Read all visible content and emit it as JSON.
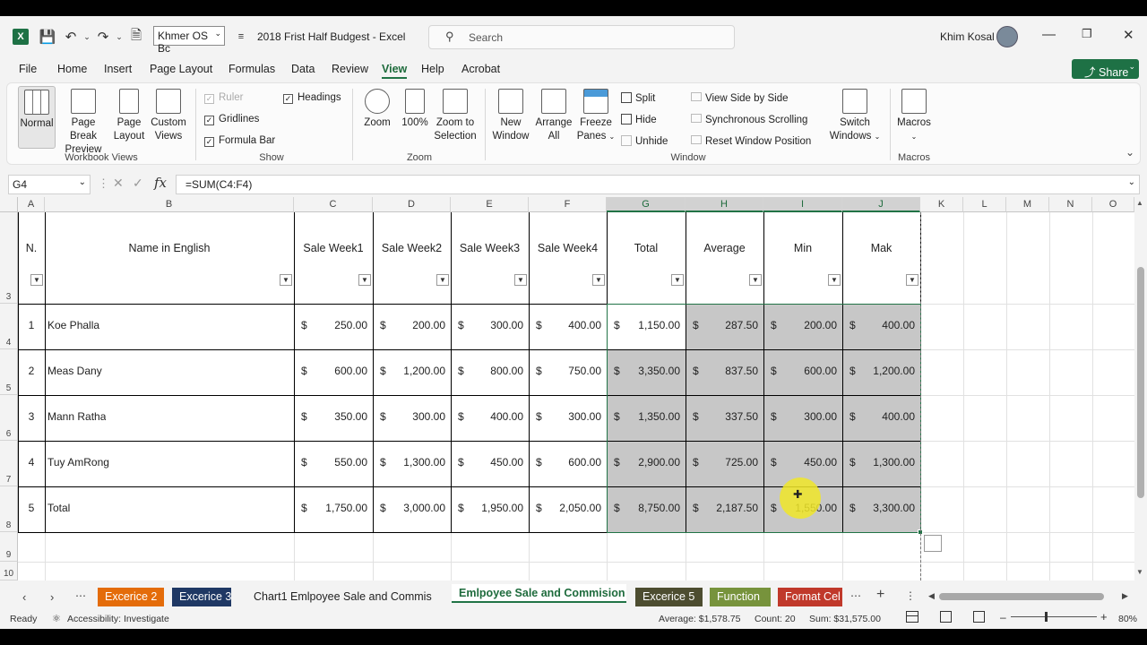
{
  "titlebar": {
    "font_name": "Khmer OS Bc",
    "doc_title": "2018 Frist Half Budgest  -  Excel",
    "search_placeholder": "Search",
    "user_name": "Khim Kosal"
  },
  "menu": {
    "items": [
      "File",
      "Home",
      "Insert",
      "Page Layout",
      "Formulas",
      "Data",
      "Review",
      "View",
      "Help",
      "Acrobat"
    ],
    "active": "View",
    "share_label": "Share"
  },
  "ribbon": {
    "workbook_views": {
      "label": "Workbook Views",
      "normal": "Normal",
      "page_break": "Page Break",
      "page_break2": "Preview",
      "page_layout": "Page",
      "page_layout2": "Layout",
      "custom_views": "Custom",
      "custom_views2": "Views"
    },
    "show": {
      "label": "Show",
      "ruler": "Ruler",
      "gridlines": "Gridlines",
      "formula_bar": "Formula Bar",
      "headings": "Headings"
    },
    "zoom": {
      "label": "Zoom",
      "zoom": "Zoom",
      "pct100": "100%",
      "zoom_sel": "Zoom to",
      "zoom_sel2": "Selection"
    },
    "window": {
      "label": "Window",
      "new_window": "New",
      "new_window2": "Window",
      "arrange": "Arrange",
      "arrange2": "All",
      "freeze": "Freeze",
      "freeze2": "Panes",
      "split": "Split",
      "hide": "Hide",
      "unhide": "Unhide",
      "side_by_side": "View Side by Side",
      "sync_scroll": "Synchronous Scrolling",
      "reset_pos": "Reset Window Position",
      "switch": "Switch",
      "switch2": "Windows"
    },
    "macros": {
      "label": "Macros",
      "macros": "Macros"
    }
  },
  "formula_bar": {
    "name_box": "G4",
    "formula": "=SUM(C4:F4)"
  },
  "columns": [
    "A",
    "B",
    "C",
    "D",
    "E",
    "F",
    "G",
    "H",
    "I",
    "J",
    "K",
    "L",
    "M",
    "N",
    "O"
  ],
  "rows": [
    "3",
    "4",
    "5",
    "6",
    "7",
    "8",
    "9",
    "10"
  ],
  "table": {
    "headers": [
      "N.",
      "Name in English",
      "Sale Week1",
      "Sale Week2",
      "Sale Week3",
      "Sale Week4",
      "Total",
      "Average",
      "Min",
      "Mak"
    ],
    "currency": "$",
    "rows": [
      {
        "n": "1",
        "name": "Koe Phalla",
        "vals": [
          "250.00",
          "200.00",
          "300.00",
          "400.00",
          "1,150.00",
          "287.50",
          "200.00",
          "400.00"
        ]
      },
      {
        "n": "2",
        "name": "Meas Dany",
        "vals": [
          "600.00",
          "1,200.00",
          "800.00",
          "750.00",
          "3,350.00",
          "837.50",
          "600.00",
          "1,200.00"
        ]
      },
      {
        "n": "3",
        "name": "Mann Ratha",
        "vals": [
          "350.00",
          "300.00",
          "400.00",
          "300.00",
          "1,350.00",
          "337.50",
          "300.00",
          "400.00"
        ]
      },
      {
        "n": "4",
        "name": "Tuy AmRong",
        "vals": [
          "550.00",
          "1,300.00",
          "450.00",
          "600.00",
          "2,900.00",
          "725.00",
          "450.00",
          "1,300.00"
        ]
      },
      {
        "n": "5",
        "name": "Total",
        "vals": [
          "1,750.00",
          "3,000.00",
          "1,950.00",
          "2,050.00",
          "8,750.00",
          "2,187.50",
          "1,550.00",
          "3,300.00"
        ]
      }
    ]
  },
  "sheet_tabs": [
    {
      "label": "Excerice 2",
      "color": "#e46c0a",
      "text": "#ffffff"
    },
    {
      "label": "Excerice 3",
      "color": "#1f3864",
      "text": "#ffffff"
    },
    {
      "label": "Chart1 Emlpoyee Sale and Commis",
      "color": "",
      "text": "#222222"
    },
    {
      "label": "Emlpoyee Sale and Commision",
      "color": "active",
      "text": "#1e6b3c"
    },
    {
      "label": "Excerice 5",
      "color": "#4d4d30",
      "text": "#ffffff"
    },
    {
      "label": "Function",
      "color": "#77933c",
      "text": "#ffffff"
    },
    {
      "label": "Format Cel",
      "color": "#c0392b",
      "text": "#ffffff"
    }
  ],
  "status": {
    "ready": "Ready",
    "accessibility": "Accessibility: Investigate",
    "average": "Average: $1,578.75",
    "count": "Count: 20",
    "sum": "Sum: $31,575.00",
    "zoom": "80%"
  },
  "colors": {
    "accent": "#217346",
    "selection": "#c6c6c6",
    "share": "#1e7145"
  }
}
